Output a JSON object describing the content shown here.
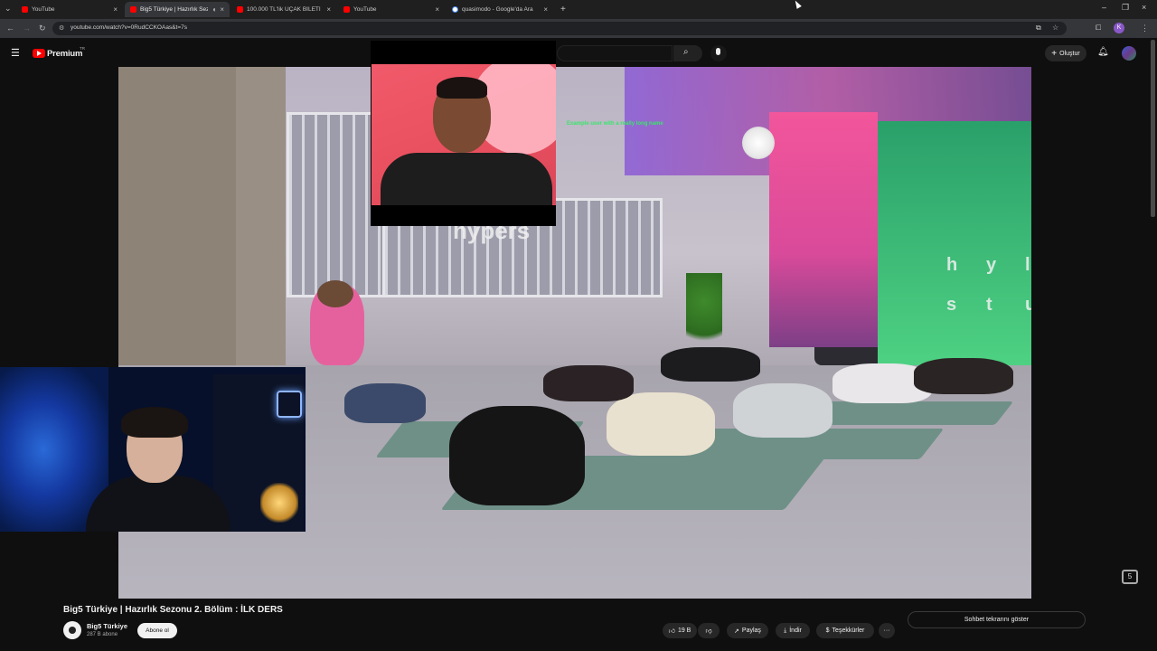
{
  "browser": {
    "tabs": [
      {
        "title": "YouTube",
        "favicon": "youtube-icon",
        "active": false
      },
      {
        "title": "Big5 Türkiye | Hazırlık Sezon",
        "favicon": "youtube-icon",
        "active": true
      },
      {
        "title": "100.000 TL'lik UÇAK BİLETİ İle",
        "favicon": "youtube-icon",
        "active": false
      },
      {
        "title": "YouTube",
        "favicon": "youtube-icon",
        "active": false
      },
      {
        "title": "quasimodo - Google'da Ara",
        "favicon": "google-icon",
        "active": false
      }
    ],
    "new_tab": "+",
    "url": "youtube.com/watch?v=0RudCCKOAas&t=7s"
  },
  "youtube": {
    "logo_text": "Premium",
    "logo_badge": "TR",
    "create_label": "Oluştur",
    "accent": "#ff0000"
  },
  "video": {
    "overlay_caption": "Example user with a really long name",
    "wordmark": "hypers",
    "wall_letters": [
      "h",
      "y",
      "l",
      "s",
      "t",
      "u"
    ]
  },
  "meta": {
    "title": "Big5 Türkiye | Hazırlık Sezonu 2. Bölüm : İLK DERS",
    "channel": "Big5 Türkiye",
    "subscribers": "287 B abone",
    "subscribe_label": "Abone ol",
    "likes": "19 B",
    "share_label": "Paylaş",
    "download_label": "İndir",
    "thanks_label": "Teşekkürler",
    "more_label": "···",
    "chat_label": "Sohbet tekrarını göster"
  }
}
